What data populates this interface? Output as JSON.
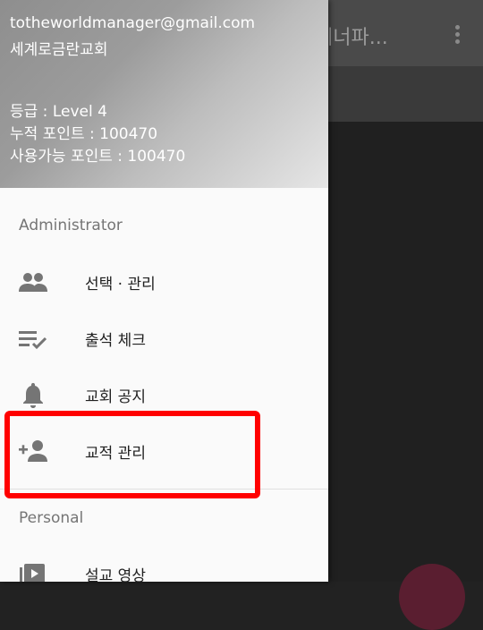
{
  "app": {
    "title": "테너파...",
    "overflow_icon": "more-vert-icon"
  },
  "drawer": {
    "header": {
      "email": "totheworldmanager@gmail.com",
      "church": "세계로금란교회",
      "grade": "등급 : Level 4",
      "cumulative_points": "누적 포인트 : 100470",
      "available_points": "사용가능 포인트 : 100470"
    },
    "sections": [
      {
        "title": "Administrator",
        "items": [
          {
            "label": "선택 · 관리",
            "icon": "people-icon"
          },
          {
            "label": "출석 체크",
            "icon": "playlist-check-icon"
          },
          {
            "label": "교회 공지",
            "icon": "bell-icon"
          },
          {
            "label": "교적 관리",
            "icon": "person-add-icon"
          }
        ]
      },
      {
        "title": "Personal",
        "items": [
          {
            "label": "설교 영상",
            "icon": "video-library-icon"
          }
        ]
      }
    ]
  },
  "colors": {
    "highlight": "#ff0000",
    "icon": "#757575",
    "fab": "#5a1e30"
  }
}
